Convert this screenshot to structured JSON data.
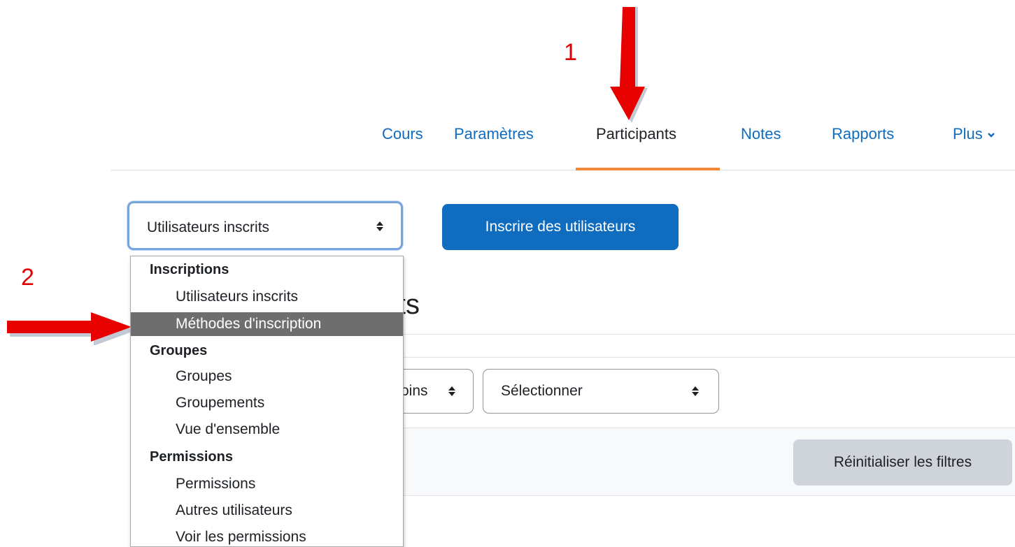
{
  "annotations": {
    "step1": "1",
    "step2": "2"
  },
  "nav": {
    "items": [
      "Cours",
      "Paramètres",
      "Participants",
      "Notes",
      "Rapports",
      "Plus"
    ],
    "active": "Participants"
  },
  "toolbar": {
    "select_value": "Utilisateurs inscrits",
    "enrol_button": "Inscrire des utilisateurs"
  },
  "dropdown": {
    "groups": [
      {
        "label": "Inscriptions",
        "options": [
          "Utilisateurs inscrits",
          "Méthodes d'inscription"
        ]
      },
      {
        "label": "Groupes",
        "options": [
          "Groupes",
          "Groupements",
          "Vue d'ensemble"
        ]
      },
      {
        "label": "Permissions",
        "options": [
          "Permissions",
          "Autres utilisateurs",
          "Voir les permissions"
        ]
      }
    ],
    "selected": "Méthodes d'inscription"
  },
  "page": {
    "heading_partial": "its",
    "filter_partial": "oins",
    "filter_select": "Sélectionner",
    "reset_button": "Réinitialiser les filtres"
  },
  "colors": {
    "link": "#0f6cbf",
    "primary": "#0f6cbf",
    "active_underline": "#f0883a",
    "annotation": "#e00000",
    "selected_option_bg": "#6e6e6e"
  }
}
